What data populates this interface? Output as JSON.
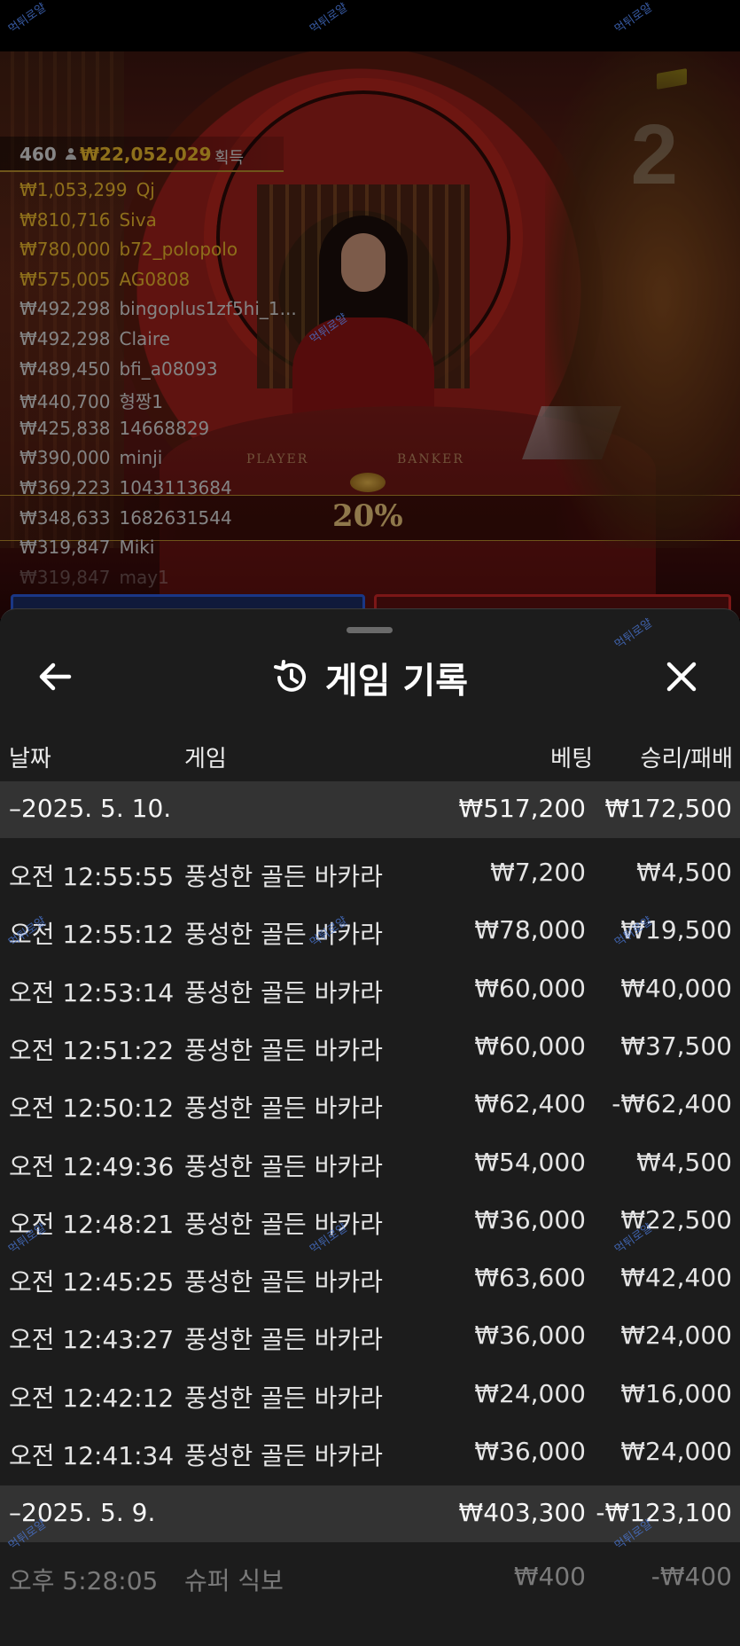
{
  "watermark": "먹튀로얄",
  "live": {
    "round_number": "2",
    "winners_header": {
      "count": "460",
      "total": "₩22,052,029",
      "suffix": "획득"
    },
    "winners": [
      {
        "amount": "₩1,053,299",
        "name": "Qj",
        "tier": "gold"
      },
      {
        "amount": "₩810,716",
        "name": "Siva",
        "tier": "gold"
      },
      {
        "amount": "₩780,000",
        "name": "b72_polopolo",
        "tier": "gold"
      },
      {
        "amount": "₩575,005",
        "name": "AG0808",
        "tier": "gold"
      },
      {
        "amount": "₩492,298",
        "name": "bingoplus1zf5hi_1...",
        "tier": "white"
      },
      {
        "amount": "₩492,298",
        "name": "Claire",
        "tier": "white"
      },
      {
        "amount": "₩489,450",
        "name": "bfi_a08093",
        "tier": "white"
      },
      {
        "amount": "₩440,700",
        "name": "형짱1",
        "tier": "white"
      },
      {
        "amount": "₩425,838",
        "name": "14668829",
        "tier": "white"
      },
      {
        "amount": "₩390,000",
        "name": "minji",
        "tier": "white"
      },
      {
        "amount": "₩369,223",
        "name": "1043113684",
        "tier": "white"
      },
      {
        "amount": "₩348,633",
        "name": "1682631544",
        "tier": "white"
      },
      {
        "amount": "₩319,847",
        "name": "Miki",
        "tier": "white"
      },
      {
        "amount": "₩319,847",
        "name": "may1",
        "tier": "white"
      }
    ],
    "table_labels": {
      "player": "PLAYER",
      "banker": "BANKER"
    },
    "percent": "20%"
  },
  "sheet": {
    "title": "게임 기록",
    "columns": {
      "date": "날짜",
      "game": "게임",
      "bet": "베팅",
      "winloss": "승리/패배"
    },
    "sections": [
      {
        "date": "–2025. 5. 10.",
        "bet": "₩517,200",
        "winloss": "₩172,500",
        "rows": [
          {
            "time": "오전 12:55:55",
            "game": "풍성한 골든 바카라",
            "bet": "₩7,200",
            "winloss": "₩4,500"
          },
          {
            "time": "오전 12:55:12",
            "game": "풍성한 골든 바카라",
            "bet": "₩78,000",
            "winloss": "₩19,500"
          },
          {
            "time": "오전 12:53:14",
            "game": "풍성한 골든 바카라",
            "bet": "₩60,000",
            "winloss": "₩40,000"
          },
          {
            "time": "오전 12:51:22",
            "game": "풍성한 골든 바카라",
            "bet": "₩60,000",
            "winloss": "₩37,500"
          },
          {
            "time": "오전 12:50:12",
            "game": "풍성한 골든 바카라",
            "bet": "₩62,400",
            "winloss": "-₩62,400"
          },
          {
            "time": "오전 12:49:36",
            "game": "풍성한 골든 바카라",
            "bet": "₩54,000",
            "winloss": "₩4,500"
          },
          {
            "time": "오전 12:48:21",
            "game": "풍성한 골든 바카라",
            "bet": "₩36,000",
            "winloss": "₩22,500"
          },
          {
            "time": "오전 12:45:25",
            "game": "풍성한 골든 바카라",
            "bet": "₩63,600",
            "winloss": "₩42,400"
          },
          {
            "time": "오전 12:43:27",
            "game": "풍성한 골든 바카라",
            "bet": "₩36,000",
            "winloss": "₩24,000"
          },
          {
            "time": "오전 12:42:12",
            "game": "풍성한 골든 바카라",
            "bet": "₩24,000",
            "winloss": "₩16,000"
          },
          {
            "time": "오전 12:41:34",
            "game": "풍성한 골든 바카라",
            "bet": "₩36,000",
            "winloss": "₩24,000"
          }
        ]
      },
      {
        "date": "–2025. 5. 9.",
        "bet": "₩403,300",
        "winloss": "-₩123,100",
        "rows": [
          {
            "time": "오후 5:28:05",
            "game": "슈퍼 식보",
            "bet": "₩400",
            "winloss": "-₩400"
          }
        ]
      }
    ]
  }
}
